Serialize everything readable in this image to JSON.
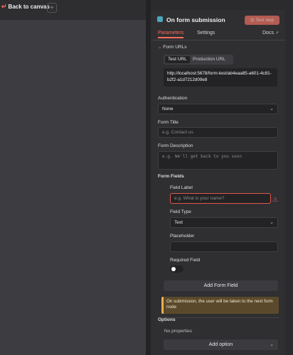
{
  "canvas": {
    "back_label": "Back to canvas",
    "add_tab": "+"
  },
  "node": {
    "title": "On form submission",
    "test_button": "Test step"
  },
  "tabs": {
    "parameters": "Parameters",
    "settings": "Settings",
    "docs": "Docs"
  },
  "form_urls": {
    "section_label": "Form URLs",
    "tab_test": "Test URL",
    "tab_production": "Production URL",
    "url": "http://localhost:5678/form-test/ab4eaa85-a601-4c81-b2f2-a1d7212d09e8"
  },
  "authentication": {
    "label": "Authentication",
    "value": "None"
  },
  "form_title": {
    "label": "Form Title",
    "placeholder": "e.g. Contact us"
  },
  "form_description": {
    "label": "Form Description",
    "placeholder": "e.g. We'll get back to you soon"
  },
  "form_fields": {
    "label": "Form Fields",
    "field_label": {
      "label": "Field Label",
      "placeholder": "e.g. What is your name?"
    },
    "field_type": {
      "label": "Field Type",
      "value": "Text"
    },
    "placeholder": {
      "label": "Placeholder",
      "value": ""
    },
    "required": {
      "label": "Required Field",
      "enabled": false
    },
    "add_button": "Add Form Field"
  },
  "notice": "On submission, the user will be taken to the next form node",
  "options": {
    "label": "Options",
    "empty": "No properties",
    "add_button": "Add option"
  },
  "colors": {
    "accent": "#ff6d5a",
    "warning": "#e8b04f",
    "error": "#e0564b"
  }
}
